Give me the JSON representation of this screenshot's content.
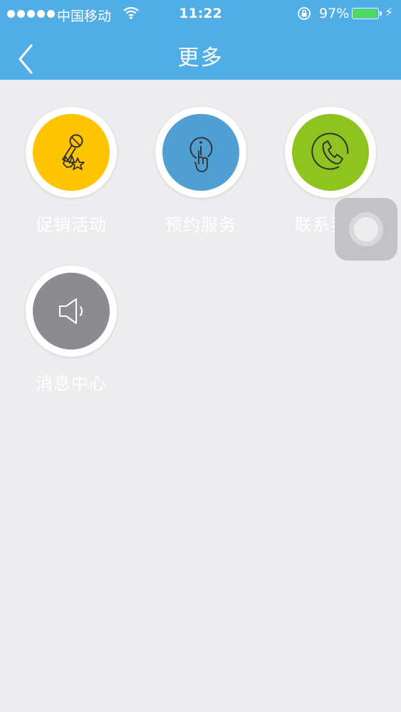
{
  "status_bar": {
    "carrier": "中国移动",
    "time": "11:22",
    "battery_percent": "97%",
    "battery_level": 0.97,
    "battery_color": "#4cd964"
  },
  "nav": {
    "title": "更多",
    "back_icon": "chevron-left-icon"
  },
  "menu": {
    "items": [
      {
        "label": "促销活动",
        "icon": "microphone-star-icon",
        "color": "#ffc400"
      },
      {
        "label": "预约服务",
        "icon": "info-touch-icon",
        "color": "#4f9fd3"
      },
      {
        "label": "联系我们",
        "icon": "phone-icon",
        "color": "#8fc31f"
      },
      {
        "label": "消息中心",
        "icon": "speaker-icon",
        "color": "#8c8b90"
      }
    ]
  },
  "colors": {
    "header": "#51ade6",
    "background": "#ededef"
  }
}
